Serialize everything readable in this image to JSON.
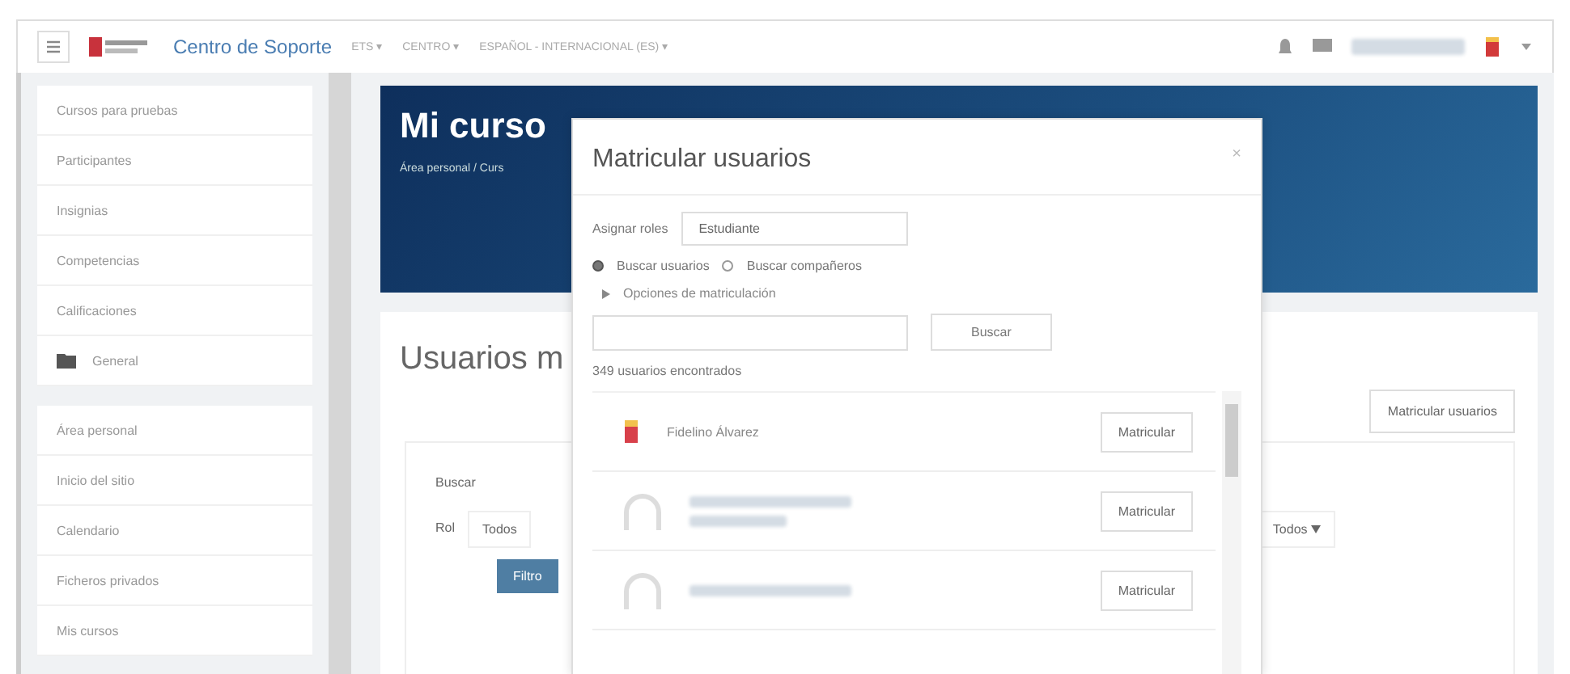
{
  "header": {
    "site_name": "Centro de Soporte",
    "nav": [
      "ETS ▾",
      "CENTRO ▾",
      "ESPAÑOL - INTERNACIONAL (ES) ▾"
    ]
  },
  "sidebar": {
    "course_items": [
      {
        "label": "Cursos para pruebas",
        "kind": "text"
      },
      {
        "label": "Participantes",
        "kind": "text"
      },
      {
        "label": "Insignias",
        "kind": "text"
      },
      {
        "label": "Competencias",
        "kind": "text"
      },
      {
        "label": "Calificaciones",
        "kind": "text"
      },
      {
        "label": "General",
        "kind": "folder"
      }
    ],
    "site_items": [
      "Área personal",
      "Inicio del sitio",
      "Calendario",
      "Ficheros privados",
      "Mis cursos"
    ]
  },
  "banner": {
    "title": "Mi curso",
    "breadcrumb": "Área personal / Curs"
  },
  "content": {
    "heading": "Usuarios m",
    "enrol_button": "Matricular usuarios",
    "search_label": "Buscar",
    "role_label": "Rol",
    "role_value": "Todos",
    "status_value": "Todos",
    "filter_button": "Filtro"
  },
  "modal": {
    "title": "Matricular usuarios",
    "close": "×",
    "assign_label": "Asignar roles",
    "assign_value": "Estudiante",
    "search_modes": [
      {
        "label": "Buscar usuarios",
        "selected": true
      },
      {
        "label": "Buscar compañeros",
        "selected": false
      }
    ],
    "options_toggle": "Opciones de matriculación",
    "search_button": "Buscar",
    "found": "349 usuarios encontrados",
    "users": [
      {
        "kind": "named",
        "name": "Fidelino Álvarez",
        "button": "Matricular"
      },
      {
        "kind": "twoline",
        "button": "Matricular"
      },
      {
        "kind": "oneline",
        "button": "Matricular"
      }
    ]
  }
}
